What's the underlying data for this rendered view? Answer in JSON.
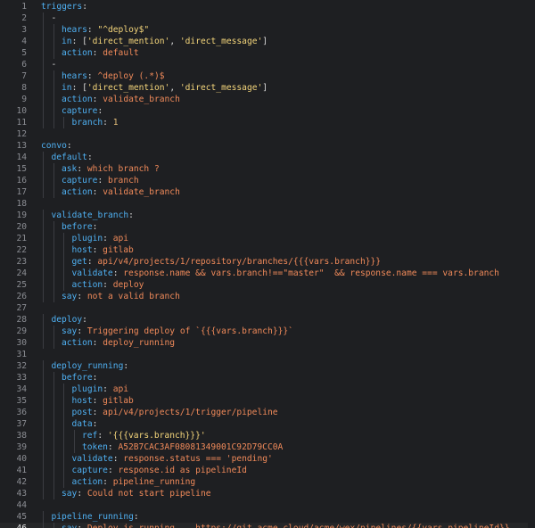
{
  "editor": {
    "language": "yaml",
    "current_line": 46,
    "lines": [
      {
        "n": "1",
        "indent": 0,
        "tokens": [
          {
            "t": "triggers",
            "c": "k"
          },
          {
            "t": ":",
            "c": "p"
          }
        ]
      },
      {
        "n": "2",
        "indent": 1,
        "tokens": [
          {
            "t": "-",
            "c": "p"
          }
        ]
      },
      {
        "n": "3",
        "indent": 2,
        "tokens": [
          {
            "t": "hears",
            "c": "k"
          },
          {
            "t": ": ",
            "c": "p"
          },
          {
            "t": "\"^deploy$\"",
            "c": "s"
          }
        ]
      },
      {
        "n": "4",
        "indent": 2,
        "tokens": [
          {
            "t": "in",
            "c": "k"
          },
          {
            "t": ": [",
            "c": "p"
          },
          {
            "t": "'direct_mention'",
            "c": "s"
          },
          {
            "t": ", ",
            "c": "p"
          },
          {
            "t": "'direct_message'",
            "c": "s"
          },
          {
            "t": "]",
            "c": "p"
          }
        ]
      },
      {
        "n": "5",
        "indent": 2,
        "tokens": [
          {
            "t": "action",
            "c": "k"
          },
          {
            "t": ": ",
            "c": "p"
          },
          {
            "t": "default",
            "c": "v"
          }
        ]
      },
      {
        "n": "6",
        "indent": 1,
        "tokens": [
          {
            "t": "-",
            "c": "p"
          }
        ]
      },
      {
        "n": "7",
        "indent": 2,
        "tokens": [
          {
            "t": "hears",
            "c": "k"
          },
          {
            "t": ": ",
            "c": "p"
          },
          {
            "t": "^deploy (.*)$",
            "c": "v"
          }
        ]
      },
      {
        "n": "8",
        "indent": 2,
        "tokens": [
          {
            "t": "in",
            "c": "k"
          },
          {
            "t": ": [",
            "c": "p"
          },
          {
            "t": "'direct_mention'",
            "c": "s"
          },
          {
            "t": ", ",
            "c": "p"
          },
          {
            "t": "'direct_message'",
            "c": "s"
          },
          {
            "t": "]",
            "c": "p"
          }
        ]
      },
      {
        "n": "9",
        "indent": 2,
        "tokens": [
          {
            "t": "action",
            "c": "k"
          },
          {
            "t": ": ",
            "c": "p"
          },
          {
            "t": "validate_branch",
            "c": "v"
          }
        ]
      },
      {
        "n": "10",
        "indent": 2,
        "tokens": [
          {
            "t": "capture",
            "c": "k"
          },
          {
            "t": ":",
            "c": "p"
          }
        ]
      },
      {
        "n": "11",
        "indent": 3,
        "tokens": [
          {
            "t": "branch",
            "c": "k"
          },
          {
            "t": ": ",
            "c": "p"
          },
          {
            "t": "1",
            "c": "n"
          }
        ]
      },
      {
        "n": "12",
        "indent": 0,
        "tokens": []
      },
      {
        "n": "13",
        "indent": 0,
        "tokens": [
          {
            "t": "convo",
            "c": "k"
          },
          {
            "t": ":",
            "c": "p"
          }
        ]
      },
      {
        "n": "14",
        "indent": 1,
        "tokens": [
          {
            "t": "default",
            "c": "k"
          },
          {
            "t": ":",
            "c": "p"
          }
        ]
      },
      {
        "n": "15",
        "indent": 2,
        "tokens": [
          {
            "t": "ask",
            "c": "k"
          },
          {
            "t": ": ",
            "c": "p"
          },
          {
            "t": "which branch ?",
            "c": "v"
          }
        ]
      },
      {
        "n": "16",
        "indent": 2,
        "tokens": [
          {
            "t": "capture",
            "c": "k"
          },
          {
            "t": ": ",
            "c": "p"
          },
          {
            "t": "branch",
            "c": "v"
          }
        ]
      },
      {
        "n": "17",
        "indent": 2,
        "tokens": [
          {
            "t": "action",
            "c": "k"
          },
          {
            "t": ": ",
            "c": "p"
          },
          {
            "t": "validate_branch",
            "c": "v"
          }
        ]
      },
      {
        "n": "18",
        "indent": 0,
        "tokens": []
      },
      {
        "n": "19",
        "indent": 1,
        "tokens": [
          {
            "t": "validate_branch",
            "c": "k"
          },
          {
            "t": ":",
            "c": "p"
          }
        ]
      },
      {
        "n": "20",
        "indent": 2,
        "tokens": [
          {
            "t": "before",
            "c": "k"
          },
          {
            "t": ":",
            "c": "p"
          }
        ]
      },
      {
        "n": "21",
        "indent": 3,
        "tokens": [
          {
            "t": "plugin",
            "c": "k"
          },
          {
            "t": ": ",
            "c": "p"
          },
          {
            "t": "api",
            "c": "v"
          }
        ]
      },
      {
        "n": "22",
        "indent": 3,
        "tokens": [
          {
            "t": "host",
            "c": "k"
          },
          {
            "t": ": ",
            "c": "p"
          },
          {
            "t": "gitlab",
            "c": "v"
          }
        ]
      },
      {
        "n": "23",
        "indent": 3,
        "tokens": [
          {
            "t": "get",
            "c": "k"
          },
          {
            "t": ": ",
            "c": "p"
          },
          {
            "t": "api/v4/projects/1/repository/branches/{{{vars.branch}}}",
            "c": "v"
          }
        ]
      },
      {
        "n": "24",
        "indent": 3,
        "tokens": [
          {
            "t": "validate",
            "c": "k"
          },
          {
            "t": ": ",
            "c": "p"
          },
          {
            "t": "response.name && vars.branch!==\"master\"  && response.name === vars.branch",
            "c": "v"
          }
        ]
      },
      {
        "n": "25",
        "indent": 3,
        "tokens": [
          {
            "t": "action",
            "c": "k"
          },
          {
            "t": ": ",
            "c": "p"
          },
          {
            "t": "deploy",
            "c": "v"
          }
        ]
      },
      {
        "n": "26",
        "indent": 2,
        "tokens": [
          {
            "t": "say",
            "c": "k"
          },
          {
            "t": ": ",
            "c": "p"
          },
          {
            "t": "not a valid branch",
            "c": "v"
          }
        ]
      },
      {
        "n": "27",
        "indent": 0,
        "tokens": []
      },
      {
        "n": "28",
        "indent": 1,
        "tokens": [
          {
            "t": "deploy",
            "c": "k"
          },
          {
            "t": ":",
            "c": "p"
          }
        ]
      },
      {
        "n": "29",
        "indent": 2,
        "tokens": [
          {
            "t": "say",
            "c": "k"
          },
          {
            "t": ": ",
            "c": "p"
          },
          {
            "t": "Triggering deploy of `{{{vars.branch}}}`",
            "c": "v"
          }
        ]
      },
      {
        "n": "30",
        "indent": 2,
        "tokens": [
          {
            "t": "action",
            "c": "k"
          },
          {
            "t": ": ",
            "c": "p"
          },
          {
            "t": "deploy_running",
            "c": "v"
          }
        ]
      },
      {
        "n": "31",
        "indent": 0,
        "tokens": []
      },
      {
        "n": "32",
        "indent": 1,
        "tokens": [
          {
            "t": "deploy_running",
            "c": "k"
          },
          {
            "t": ":",
            "c": "p"
          }
        ]
      },
      {
        "n": "33",
        "indent": 2,
        "tokens": [
          {
            "t": "before",
            "c": "k"
          },
          {
            "t": ":",
            "c": "p"
          }
        ]
      },
      {
        "n": "34",
        "indent": 3,
        "tokens": [
          {
            "t": "plugin",
            "c": "k"
          },
          {
            "t": ": ",
            "c": "p"
          },
          {
            "t": "api",
            "c": "v"
          }
        ]
      },
      {
        "n": "35",
        "indent": 3,
        "tokens": [
          {
            "t": "host",
            "c": "k"
          },
          {
            "t": ": ",
            "c": "p"
          },
          {
            "t": "gitlab",
            "c": "v"
          }
        ]
      },
      {
        "n": "36",
        "indent": 3,
        "tokens": [
          {
            "t": "post",
            "c": "k"
          },
          {
            "t": ": ",
            "c": "p"
          },
          {
            "t": "api/v4/projects/1/trigger/pipeline",
            "c": "v"
          }
        ]
      },
      {
        "n": "37",
        "indent": 3,
        "tokens": [
          {
            "t": "data",
            "c": "k"
          },
          {
            "t": ":",
            "c": "p"
          }
        ]
      },
      {
        "n": "38",
        "indent": 4,
        "tokens": [
          {
            "t": "ref",
            "c": "k"
          },
          {
            "t": ": ",
            "c": "p"
          },
          {
            "t": "'{{{vars.branch}}}'",
            "c": "s"
          }
        ]
      },
      {
        "n": "39",
        "indent": 4,
        "tokens": [
          {
            "t": "token",
            "c": "k"
          },
          {
            "t": ": ",
            "c": "p"
          },
          {
            "t": "A52B7CAC3AF08081349001C92D79CC0A",
            "c": "v"
          }
        ]
      },
      {
        "n": "40",
        "indent": 3,
        "tokens": [
          {
            "t": "validate",
            "c": "k"
          },
          {
            "t": ": ",
            "c": "p"
          },
          {
            "t": "response.status === 'pending'",
            "c": "v"
          }
        ]
      },
      {
        "n": "41",
        "indent": 3,
        "tokens": [
          {
            "t": "capture",
            "c": "k"
          },
          {
            "t": ": ",
            "c": "p"
          },
          {
            "t": "response.id as pipelineId",
            "c": "v"
          }
        ]
      },
      {
        "n": "42",
        "indent": 3,
        "tokens": [
          {
            "t": "action",
            "c": "k"
          },
          {
            "t": ": ",
            "c": "p"
          },
          {
            "t": "pipeline_running",
            "c": "v"
          }
        ]
      },
      {
        "n": "43",
        "indent": 2,
        "tokens": [
          {
            "t": "say",
            "c": "k"
          },
          {
            "t": ": ",
            "c": "p"
          },
          {
            "t": "Could not start pipeline",
            "c": "v"
          }
        ]
      },
      {
        "n": "44",
        "indent": 0,
        "tokens": []
      },
      {
        "n": "45",
        "indent": 1,
        "tokens": [
          {
            "t": "pipeline_running",
            "c": "k"
          },
          {
            "t": ":",
            "c": "p"
          }
        ]
      },
      {
        "n": "46",
        "indent": 2,
        "tokens": [
          {
            "t": "say",
            "c": "k"
          },
          {
            "t": ": ",
            "c": "p"
          },
          {
            "t": "Deploy is running... https://git.acme.cloud/acme/wex/pipelines/{{vars.pipelineId}}",
            "c": "v"
          }
        ]
      }
    ]
  },
  "colors": {
    "background": "#1e1f22",
    "key": "#4fb0f2",
    "string": "#f5d67b",
    "value": "#f08a5a",
    "line_number": "#8b8d93"
  }
}
